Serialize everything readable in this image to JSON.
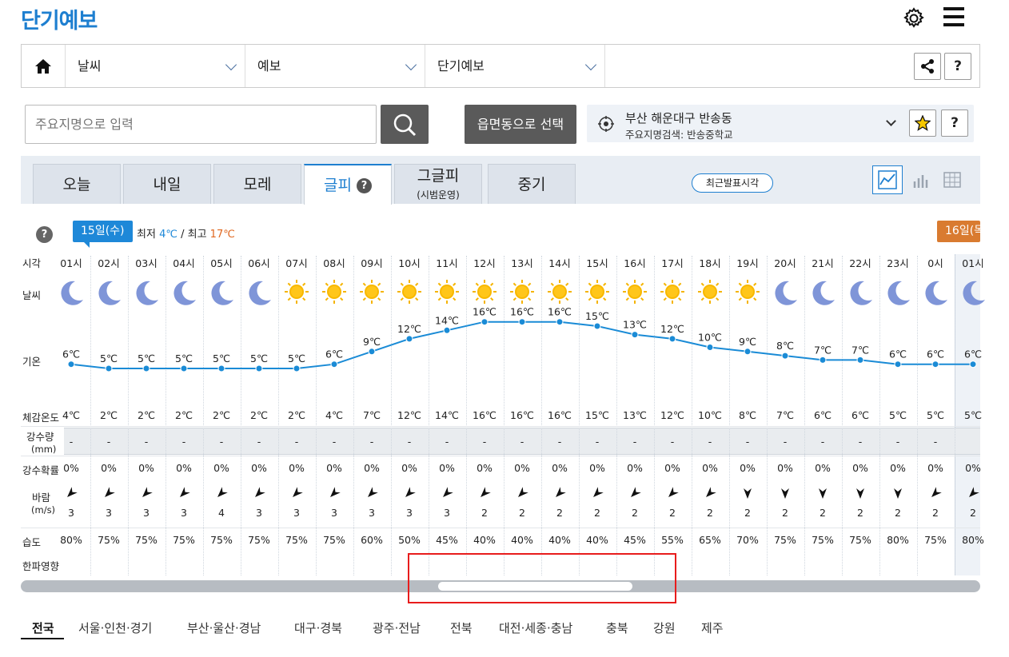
{
  "header": {
    "title": "단기예보"
  },
  "nav": {
    "item1": "날씨",
    "item2": "예보",
    "item3": "단기예보",
    "help": "?"
  },
  "search": {
    "placeholder": "주요지명으로 입력",
    "region_button": "읍면동으로 선택"
  },
  "location": {
    "name": "부산 해운대구 반송동",
    "sub": "주요지명검색: 반송중학교",
    "help": "?"
  },
  "tabs": [
    {
      "label": "오늘"
    },
    {
      "label": "내일"
    },
    {
      "label": "모레"
    },
    {
      "label": "글피",
      "help": "?"
    },
    {
      "label": "그글피",
      "sub": "(시범운영)"
    },
    {
      "label": "중기"
    }
  ],
  "recent_button": "최근발표시각",
  "day1": {
    "badge": "15일(수)",
    "min_label": "최저",
    "min": "4℃",
    "sep": "/",
    "max_label": "최고",
    "max": "17℃"
  },
  "day2": {
    "badge": "16일(목"
  },
  "row_labels": {
    "help": "?",
    "time": "시각",
    "weather": "날씨",
    "temp": "기온",
    "feel": "체감온도",
    "rain": "강수량",
    "rain_unit": "(mm)",
    "prob": "강수확률",
    "wind": "바람",
    "wind_unit": "(m/s)",
    "humidity": "습도",
    "cold": "한파영향"
  },
  "hours": [
    "01시",
    "02시",
    "03시",
    "04시",
    "05시",
    "06시",
    "07시",
    "08시",
    "09시",
    "10시",
    "11시",
    "12시",
    "13시",
    "14시",
    "15시",
    "16시",
    "17시",
    "18시",
    "19시",
    "20시",
    "21시",
    "22시",
    "23시",
    "0시",
    "01시"
  ],
  "weather": [
    "moon-icon",
    "moon-icon",
    "moon-icon",
    "moon-icon",
    "moon-icon",
    "moon-icon",
    "sun-icon",
    "sun-icon",
    "sun-icon",
    "sun-icon",
    "sun-icon",
    "sun-icon",
    "sun-icon",
    "sun-icon",
    "sun-icon",
    "sun-icon",
    "sun-icon",
    "sun-icon",
    "sun-icon",
    "moon-icon",
    "moon-icon",
    "moon-icon",
    "moon-icon",
    "moon-icon",
    "moon-icon"
  ],
  "temps": [
    6,
    5,
    5,
    5,
    5,
    5,
    5,
    6,
    9,
    12,
    14,
    16,
    16,
    16,
    15,
    13,
    12,
    10,
    9,
    8,
    7,
    7,
    6,
    6,
    6
  ],
  "temp_labels": [
    "6℃",
    "5℃",
    "5℃",
    "5℃",
    "5℃",
    "5℃",
    "5℃",
    "6℃",
    "9℃",
    "12℃",
    "14℃",
    "16℃",
    "16℃",
    "16℃",
    "15℃",
    "13℃",
    "12℃",
    "10℃",
    "9℃",
    "8℃",
    "7℃",
    "7℃",
    "6℃",
    "6℃",
    "6℃"
  ],
  "feel": [
    "4℃",
    "2℃",
    "2℃",
    "2℃",
    "2℃",
    "2℃",
    "2℃",
    "4℃",
    "7℃",
    "12℃",
    "14℃",
    "16℃",
    "16℃",
    "16℃",
    "15℃",
    "13℃",
    "12℃",
    "10℃",
    "8℃",
    "7℃",
    "6℃",
    "6℃",
    "5℃",
    "5℃",
    "5℃"
  ],
  "rain": [
    "-",
    "-",
    "-",
    "-",
    "-",
    "-",
    "-",
    "-",
    "-",
    "-",
    "-",
    "-",
    "-",
    "-",
    "-",
    "-",
    "-",
    "-",
    "-",
    "-",
    "-",
    "-",
    "-",
    "-",
    ""
  ],
  "prob": [
    "0%",
    "0%",
    "0%",
    "0%",
    "0%",
    "0%",
    "0%",
    "0%",
    "0%",
    "0%",
    "0%",
    "0%",
    "0%",
    "0%",
    "0%",
    "0%",
    "0%",
    "0%",
    "0%",
    "0%",
    "0%",
    "0%",
    "0%",
    "0%",
    "0%"
  ],
  "wind_dir": [
    "ne",
    "ne",
    "ne",
    "ne",
    "ne",
    "ne",
    "ne",
    "ne",
    "ne",
    "ne",
    "ne",
    "ne",
    "ne",
    "ne",
    "ne",
    "ne",
    "ne",
    "ne",
    "n",
    "n",
    "n",
    "n",
    "n",
    "ne",
    "ne"
  ],
  "wind_speed": [
    "3",
    "3",
    "3",
    "3",
    "4",
    "3",
    "3",
    "3",
    "3",
    "3",
    "3",
    "2",
    "2",
    "2",
    "2",
    "2",
    "2",
    "2",
    "2",
    "2",
    "2",
    "2",
    "2",
    "2",
    "2"
  ],
  "humidity": [
    "80%",
    "75%",
    "75%",
    "75%",
    "75%",
    "75%",
    "75%",
    "75%",
    "60%",
    "50%",
    "45%",
    "40%",
    "40%",
    "40%",
    "40%",
    "45%",
    "55%",
    "65%",
    "70%",
    "75%",
    "75%",
    "75%",
    "80%",
    "75%",
    "80%"
  ],
  "regions": [
    "전국",
    "서울·인천·경기",
    "부산·울산·경남",
    "대구·경북",
    "광주·전남",
    "전북",
    "대전·세종·충남",
    "충북",
    "강원",
    "제주"
  ],
  "colors": {
    "accent": "#1e7fd0",
    "line": "#1a8bd6",
    "sun": "#f5b400",
    "moon": "#7d92d6",
    "highlight": "#e81c1c"
  }
}
